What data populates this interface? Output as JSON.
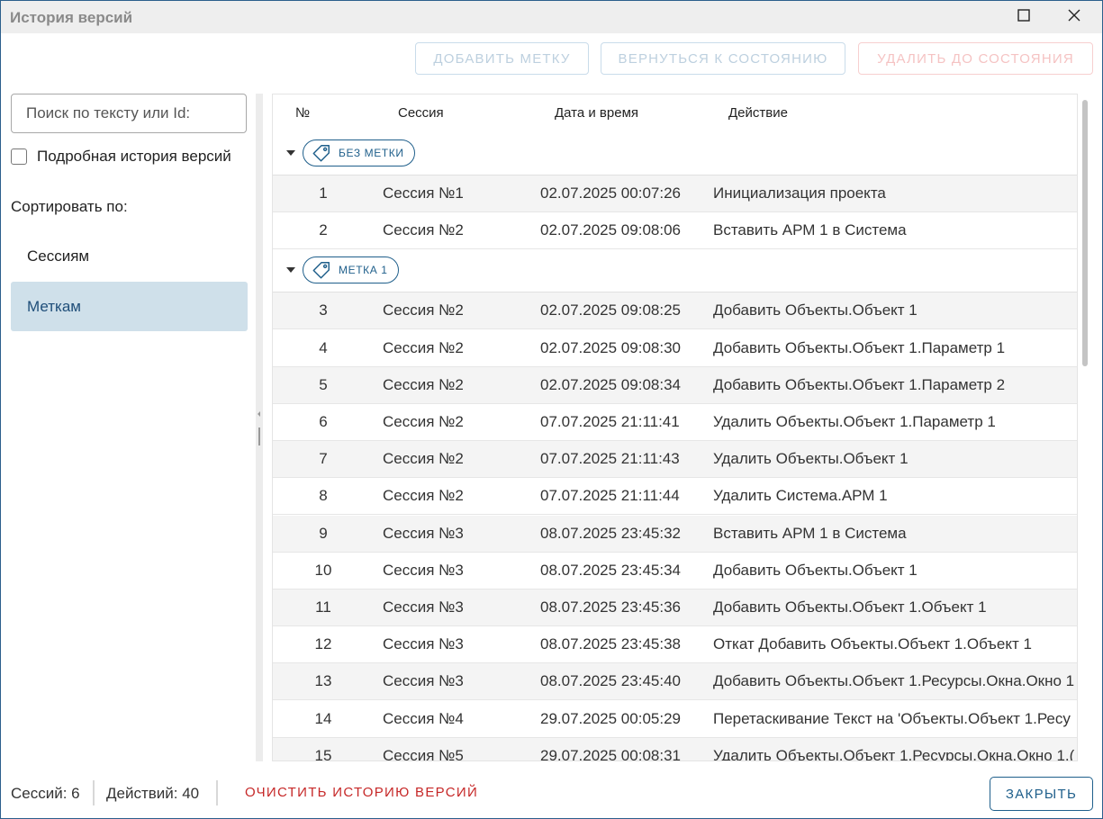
{
  "window": {
    "title": "История версий"
  },
  "toolbar": {
    "add_tag": "ДОБАВИТЬ МЕТКУ",
    "revert": "ВЕРНУТЬСЯ К СОСТОЯНИЮ",
    "delete_until": "УДАЛИТЬ ДО СОСТОЯНИЯ"
  },
  "sidebar": {
    "search_placeholder": "Поиск по тексту или Id:",
    "detailed_label": "Подробная история версий",
    "detailed_checked": false,
    "sort_label": "Сортировать по:",
    "sort_options": [
      "Сессиям",
      "Меткам"
    ],
    "sort_selected": "Меткам"
  },
  "grid": {
    "columns": [
      "№",
      "Сессия",
      "Дата и время",
      "Действие"
    ],
    "groups": [
      {
        "tag": "БЕЗ МЕТКИ",
        "rows": [
          {
            "num": "1",
            "session": "Сессия №1",
            "datetime": "02.07.2025 00:07:26",
            "action": "Инициализация проекта"
          },
          {
            "num": "2",
            "session": "Сессия №2",
            "datetime": "02.07.2025 09:08:06",
            "action": "Вставить АРМ 1 в Система"
          }
        ]
      },
      {
        "tag": "МЕТКА 1",
        "rows": [
          {
            "num": "3",
            "session": "Сессия №2",
            "datetime": "02.07.2025 09:08:25",
            "action": "Добавить Объекты.Объект 1"
          },
          {
            "num": "4",
            "session": "Сессия №2",
            "datetime": "02.07.2025 09:08:30",
            "action": "Добавить Объекты.Объект 1.Параметр 1"
          },
          {
            "num": "5",
            "session": "Сессия №2",
            "datetime": "02.07.2025 09:08:34",
            "action": "Добавить Объекты.Объект 1.Параметр 2"
          },
          {
            "num": "6",
            "session": "Сессия №2",
            "datetime": "07.07.2025 21:11:41",
            "action": "Удалить Объекты.Объект 1.Параметр 1"
          },
          {
            "num": "7",
            "session": "Сессия №2",
            "datetime": "07.07.2025 21:11:43",
            "action": "Удалить Объекты.Объект 1"
          },
          {
            "num": "8",
            "session": "Сессия №2",
            "datetime": "07.07.2025 21:11:44",
            "action": "Удалить Система.АРМ 1"
          },
          {
            "num": "9",
            "session": "Сессия №3",
            "datetime": "08.07.2025 23:45:32",
            "action": "Вставить АРМ 1 в Система"
          },
          {
            "num": "10",
            "session": "Сессия №3",
            "datetime": "08.07.2025 23:45:34",
            "action": "Добавить Объекты.Объект 1"
          },
          {
            "num": "11",
            "session": "Сессия №3",
            "datetime": "08.07.2025 23:45:36",
            "action": "Добавить Объекты.Объект 1.Объект 1"
          },
          {
            "num": "12",
            "session": "Сессия №3",
            "datetime": "08.07.2025 23:45:38",
            "action": "Откат Добавить Объекты.Объект 1.Объект 1"
          },
          {
            "num": "13",
            "session": "Сессия №3",
            "datetime": "08.07.2025 23:45:40",
            "action": "Добавить Объекты.Объект 1.Ресурсы.Окна.Окно 1"
          },
          {
            "num": "14",
            "session": "Сессия №4",
            "datetime": "29.07.2025 00:05:29",
            "action": "Перетаскивание Текст на 'Объекты.Объект 1.Ресу"
          },
          {
            "num": "15",
            "session": "Сессия №5",
            "datetime": "29.07.2025 00:08:31",
            "action": "Удалить Объекты.Объект 1.Ресурсы.Окна.Окно 1.("
          }
        ]
      }
    ]
  },
  "footer": {
    "sessions": "Сессий: 6",
    "actions": "Действий: 40",
    "clear": "ОЧИСТИТЬ ИСТОРИЮ ВЕРСИЙ",
    "close": "ЗАКРЫТЬ"
  }
}
